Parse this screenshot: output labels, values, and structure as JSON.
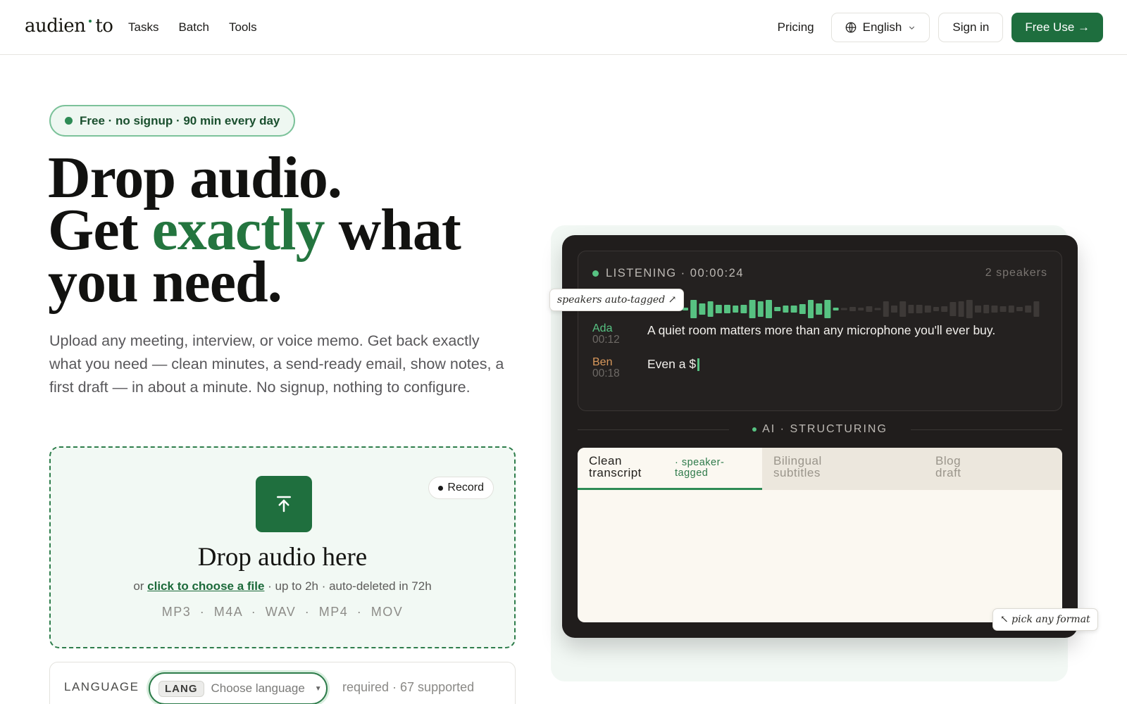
{
  "nav": {
    "logo_left": "audien",
    "logo_right": "to",
    "links": [
      "Tasks",
      "Batch",
      "Tools"
    ],
    "pricing": "Pricing",
    "language": "English",
    "sign_in": "Sign in",
    "free_use": "Free Use →"
  },
  "hero": {
    "badge": "Free · no signup · 90 min every day",
    "headline_line1": "Drop audio.",
    "headline_line2_a": "Get ",
    "headline_line2_accent": "exactly",
    "headline_line2_b": " what",
    "headline_line3": "you need.",
    "subtext": "Upload any meeting, interview, or voice memo. Get back exactly what you need — clean minutes, a send-ready email, show notes, a first draft — in about a minute. No signup, nothing to configure."
  },
  "dropzone": {
    "record": "Record",
    "title": "Drop audio here",
    "or": "or ",
    "choose_link": "click to choose a file",
    "limits": " · up to 2h · auto-deleted in 72h",
    "formats": [
      "MP3",
      "M4A",
      "WAV",
      "MP4",
      "MOV"
    ]
  },
  "language": {
    "label": "LANGUAGE",
    "tag": "LANG",
    "placeholder": "Choose language",
    "note": "required · 67 supported"
  },
  "demo": {
    "listening": "LISTENING · 00:00:24",
    "speakers": "2 speakers",
    "annotation_speakers": "speakers auto-tagged ↗",
    "transcript": [
      {
        "speaker": "Ada",
        "time": "00:12",
        "text": "A quiet room matters more than any microphone you'll ever buy.",
        "color": "#57c282"
      },
      {
        "speaker": "Ben",
        "time": "00:18",
        "text": "Even a $",
        "color": "#d9995c"
      }
    ],
    "ai_label": "AI · STRUCTURING",
    "tabs": [
      {
        "label": "Clean transcript",
        "sub": "· speaker-tagged"
      },
      {
        "label": "Bilingual subtitles"
      },
      {
        "label": "Blog draft"
      }
    ],
    "annotation_format": "↖ pick any format"
  },
  "colors": {
    "brand_green": "#1e6e3e",
    "accent_green": "#24753f",
    "wave_active": "#57c282",
    "dark_panel": "#201d1c"
  }
}
